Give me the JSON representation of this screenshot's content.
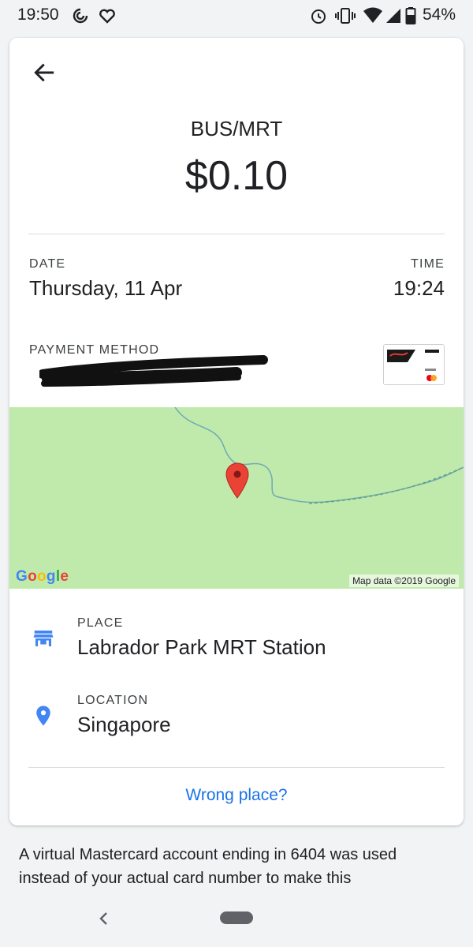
{
  "status_bar": {
    "time": "19:50",
    "battery": "54%",
    "icons": [
      "sync-icon",
      "heart-icon",
      "alarm-icon",
      "vibrate-icon",
      "wifi-icon",
      "signal-icon",
      "battery-icon"
    ]
  },
  "transaction": {
    "category": "BUS/MRT",
    "amount": "$0.10",
    "date_label": "DATE",
    "date_value": "Thursday, 11 Apr",
    "time_label": "TIME",
    "time_value": "19:24",
    "payment_label": "PAYMENT METHOD"
  },
  "map": {
    "logo": "Google",
    "attribution": "Map data ©2019 Google"
  },
  "place": {
    "label": "PLACE",
    "value": "Labrador Park MRT Station"
  },
  "location": {
    "label": "LOCATION",
    "value": "Singapore"
  },
  "wrong_place": "Wrong place?",
  "footer_note": "A virtual Mastercard account ending in 6404 was used instead of your actual card number to make this",
  "colors": {
    "accent": "#1a73e8",
    "map_green": "#c0eaab",
    "pin_red": "#ea4335",
    "place_icon_blue": "#4285f4"
  }
}
